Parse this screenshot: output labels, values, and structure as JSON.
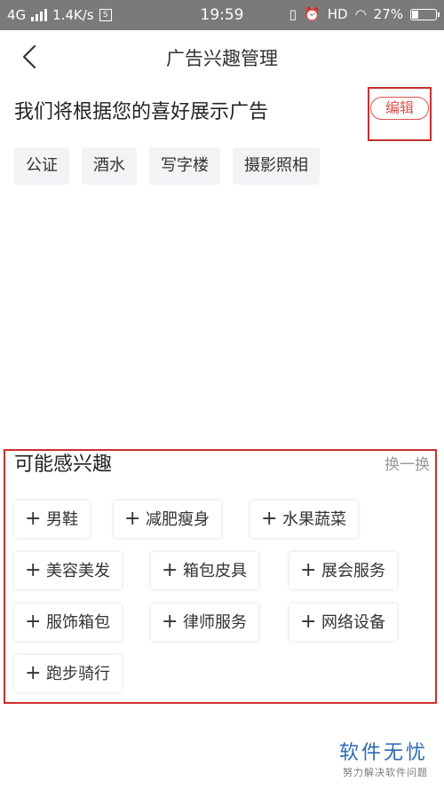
{
  "status_bar": {
    "network": "4G",
    "speed": "1.4K/s",
    "time": "19:59",
    "hd": "HD",
    "battery": "27%",
    "battery_level": 0.27
  },
  "nav": {
    "title": "广告兴趣管理"
  },
  "interests": {
    "headline": "我们将根据您的喜好展示广告",
    "edit_label": "编辑",
    "tags": [
      "公证",
      "酒水",
      "写字楼",
      "摄影照相"
    ]
  },
  "suggestions": {
    "title": "可能感兴趣",
    "refresh_label": "换一换",
    "items": [
      "男鞋",
      "减肥瘦身",
      "水果蔬菜",
      "美容美发",
      "箱包皮具",
      "展会服务",
      "服饰箱包",
      "律师服务",
      "网络设备",
      "跑步骑行"
    ]
  },
  "watermark": {
    "main": "软件无忧",
    "sub": "努力解决软件问题"
  },
  "colors": {
    "accent_red": "#d9534f",
    "highlight_box": "#c9302c",
    "watermark_blue": "#2c6bb3"
  }
}
